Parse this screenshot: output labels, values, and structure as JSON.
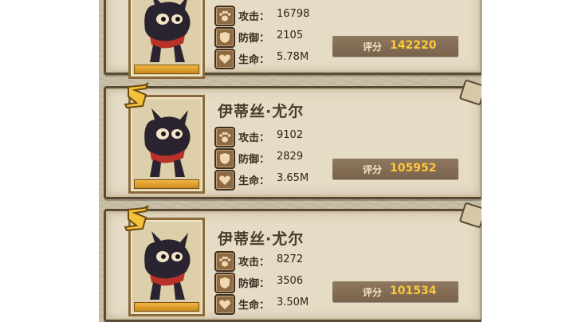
{
  "entries": [
    {
      "name": "",
      "rank": "",
      "stats": {
        "attack_label": "攻击：",
        "attack": "16798",
        "defense_label": "防御：",
        "defense": "2105",
        "hp_label": "生命：",
        "hp": "5.78M"
      },
      "score_label": "评分",
      "score": "142220"
    },
    {
      "name": "伊蒂丝·尤尔",
      "rank": "S",
      "stats": {
        "attack_label": "攻击：",
        "attack": "9102",
        "defense_label": "防御：",
        "defense": "2829",
        "hp_label": "生命：",
        "hp": "3.65M"
      },
      "score_label": "评分",
      "score": "105952"
    },
    {
      "name": "伊蒂丝·尤尔",
      "rank": "S",
      "stats": {
        "attack_label": "攻击：",
        "attack": "8272",
        "defense_label": "防御：",
        "defense": "3506",
        "hp_label": "生命：",
        "hp": "3.50M"
      },
      "score_label": "评分",
      "score": "101534"
    }
  ],
  "icons": [
    "paw-icon",
    "shield-icon",
    "heart-icon",
    "cat-portrait-icon"
  ],
  "colors": {
    "score_value": "#ffc93a",
    "panel_bg": "#e6dcc6",
    "border": "#5a4a36",
    "gold_bar": "#f2b640"
  }
}
